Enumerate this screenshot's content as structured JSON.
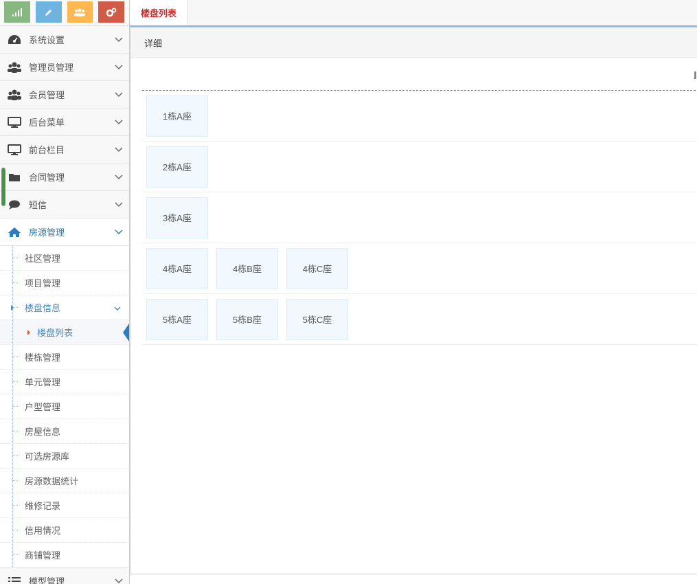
{
  "sidebar": {
    "shortcuts": [
      {
        "icon": "signal-icon",
        "color": "#87b87f"
      },
      {
        "icon": "pencil-icon",
        "color": "#6fb3e0"
      },
      {
        "icon": "users-icon",
        "color": "#ffb752"
      },
      {
        "icon": "cogs-icon",
        "color": "#d15b47"
      }
    ],
    "menu": [
      {
        "label": "系统设置",
        "icon": "dashboard-icon"
      },
      {
        "label": "管理员管理",
        "icon": "users-icon"
      },
      {
        "label": "会员管理",
        "icon": "users-icon"
      },
      {
        "label": "后台菜单",
        "icon": "desktop-icon"
      },
      {
        "label": "前台栏目",
        "icon": "desktop-icon"
      },
      {
        "label": "合同管理",
        "icon": "folder-icon"
      },
      {
        "label": "短信",
        "icon": "comment-icon"
      },
      {
        "label": "房源管理",
        "icon": "home-icon"
      }
    ],
    "submenu": [
      "社区管理",
      "项目管理",
      "楼盘信息",
      "楼盘列表",
      "楼栋管理",
      "单元管理",
      "户型管理",
      "房屋信息",
      "可选房源库",
      "房源数据统计",
      "维修记录",
      "信用情况",
      "商铺管理"
    ],
    "last_menu": {
      "label": "模型管理",
      "icon": "list-icon"
    }
  },
  "tabs": {
    "active": "楼盘列表"
  },
  "panel": {
    "title": "详细",
    "rows": [
      [
        "1栋A座"
      ],
      [
        "2栋A座"
      ],
      [
        "3栋A座"
      ],
      [
        "4栋A座",
        "4栋B座",
        "4栋C座"
      ],
      [
        "5栋A座",
        "5栋B座",
        "5栋C座"
      ]
    ]
  },
  "colors": {
    "accent": "#2b7dbc",
    "tab_text": "#c1302d",
    "tile_bg": "#f1f9ff"
  }
}
